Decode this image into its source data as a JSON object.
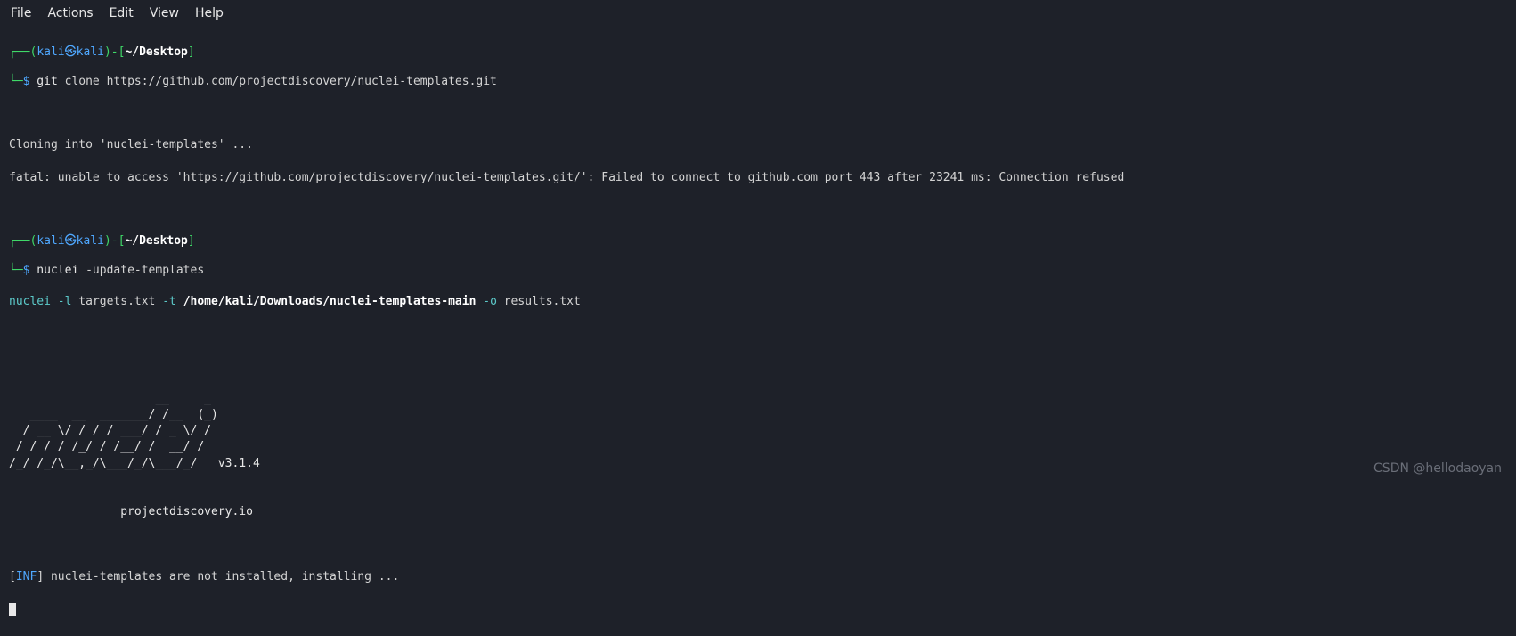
{
  "menubar": {
    "file": "File",
    "actions": "Actions",
    "edit": "Edit",
    "view": "View",
    "help": "Help"
  },
  "prompt1": {
    "box_top_open": "┌──(",
    "user": "kali",
    "skull": "㉿",
    "host": "kali",
    "box_top_close": ")-[",
    "path": "~/Desktop",
    "box_top_end": "]",
    "box_bottom": "└─",
    "dollar": "$",
    "cmd_prefix": " git",
    "cmd_rest": " clone https://github.com/projectdiscovery/nuclei-templates.git"
  },
  "output1": {
    "line1": "Cloning into 'nuclei-templates' ...",
    "line2": "fatal: unable to access 'https://github.com/projectdiscovery/nuclei-templates.git/': Failed to connect to github.com port 443 after 23241 ms: Connection refused"
  },
  "prompt2": {
    "box_top_open": "┌──(",
    "user": "kali",
    "skull": "㉿",
    "host": "kali",
    "box_top_close": ")-[",
    "path": "~/Desktop",
    "box_top_end": "]",
    "box_bottom": "└─",
    "dollar": "$",
    "cmd_prefix": " nuclei",
    "cmd_rest": " -update-templates"
  },
  "output2": {
    "part1": "nuclei -l",
    "part2": " targets.txt ",
    "part3": "-t ",
    "part4": "/home/kali/Downloads/nuclei-templates-main",
    "part5": " -o",
    "part6": " results.txt"
  },
  "ascii": {
    "l1": "                     __     _",
    "l2": "   ____  __  _______/ /__  (_)",
    "l3": "  / __ \\/ / / / ___/ / _ \\/ /",
    "l4": " / / / / /_/ / /__/ /  __/ /",
    "l5": "/_/ /_/\\__,_/\\___/_/\\___/_/   ",
    "version": "v3.1.4",
    "site": "\t\tprojectdiscovery.io"
  },
  "info": {
    "bracket_open": "[",
    "tag": "INF",
    "bracket_close": "] ",
    "msg": "nuclei-templates are not installed, installing ..."
  },
  "watermark": "CSDN @hellodaoyan"
}
